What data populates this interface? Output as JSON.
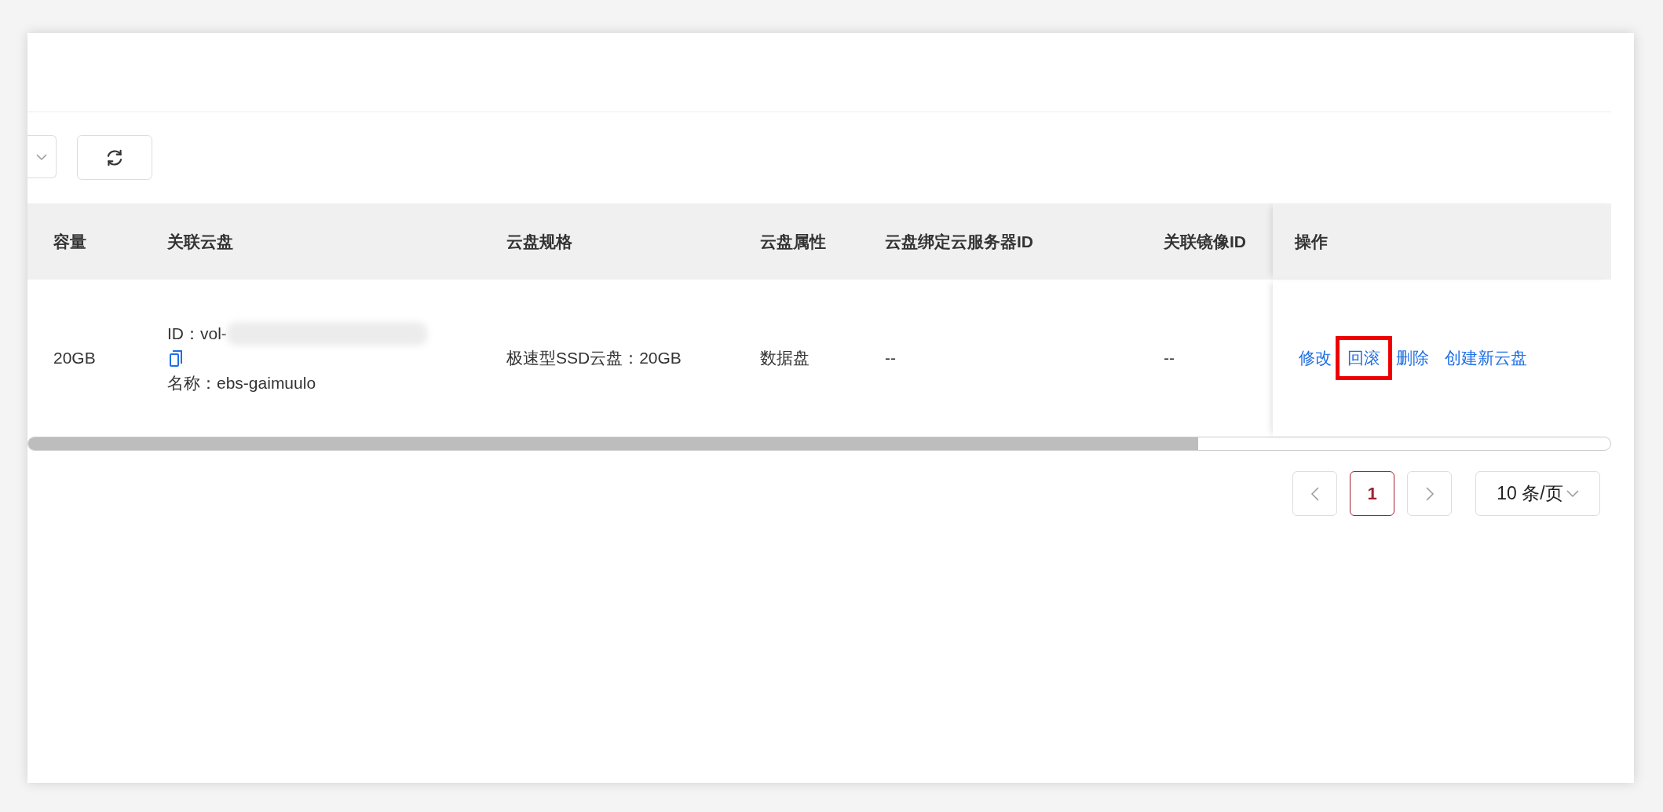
{
  "table": {
    "columns": [
      "容量",
      "关联云盘",
      "云盘规格",
      "云盘属性",
      "云盘绑定云服务器ID",
      "关联镜像ID",
      "操作"
    ],
    "rows": [
      {
        "capacity": "20GB",
        "disk_id": "ID：vol-",
        "disk_name": "名称：ebs-gaimuulo",
        "spec": "极速型SSD云盘：20GB",
        "attribute": "数据盘",
        "server_id": "--",
        "image_id": "--",
        "actions": [
          {
            "label": "修改",
            "highlighted": false
          },
          {
            "label": "回滚",
            "highlighted": true
          },
          {
            "label": "删除",
            "highlighted": false
          },
          {
            "label": "创建新云盘",
            "highlighted": false
          }
        ]
      }
    ]
  },
  "pagination": {
    "pages": [
      {
        "label": "1",
        "selected": true
      }
    ],
    "page_size": "10 条/页"
  }
}
